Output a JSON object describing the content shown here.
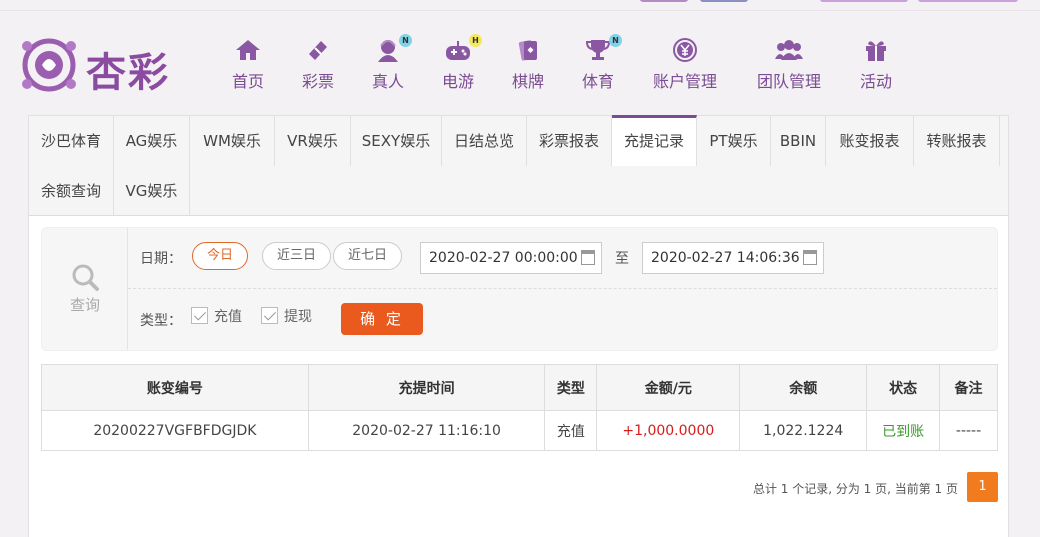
{
  "brand": {
    "name": "杏彩",
    "color": "#7b4b93",
    "accent": "#ea5a1e"
  },
  "nav": [
    {
      "label": "首页",
      "icon": "home-icon",
      "badge": ""
    },
    {
      "label": "彩票",
      "icon": "ticket-icon",
      "badge": ""
    },
    {
      "label": "真人",
      "icon": "dealer-icon",
      "badge": "N"
    },
    {
      "label": "电游",
      "icon": "gamepad-icon",
      "badge": "H"
    },
    {
      "label": "棋牌",
      "icon": "cards-icon",
      "badge": ""
    },
    {
      "label": "体育",
      "icon": "trophy-icon",
      "badge": "N"
    },
    {
      "label": "账户管理",
      "icon": "yen-icon",
      "badge": ""
    },
    {
      "label": "团队管理",
      "icon": "team-icon",
      "badge": ""
    },
    {
      "label": "活动",
      "icon": "gift-icon",
      "badge": ""
    }
  ],
  "tabs": [
    "沙巴体育",
    "AG娱乐",
    "WM娱乐",
    "VR娱乐",
    "SEXY娱乐",
    "日结总览",
    "彩票报表",
    "充提记录",
    "PT娱乐",
    "BBIN",
    "账变报表",
    "转账报表",
    "余额查询",
    "VG娱乐"
  ],
  "active_tab": "充提记录",
  "query": {
    "side_label": "查询",
    "date_label": "日期：",
    "quick": [
      "今日",
      "近三日",
      "近七日"
    ],
    "start": "2020-02-27 00:00:00",
    "to": "至",
    "end": "2020-02-27 14:06:36",
    "type_label": "类型：",
    "types": [
      "充值",
      "提现"
    ],
    "confirm": "确 定"
  },
  "table": {
    "headers": [
      "账变编号",
      "充提时间",
      "类型",
      "金额/元",
      "余额",
      "状态",
      "备注"
    ],
    "rows": [
      [
        "20200227VGFBFDGJDK",
        "2020-02-27 11:16:10",
        "充值",
        "+1,000.0000",
        "1,022.1224",
        "已到账",
        "-----"
      ]
    ]
  },
  "pager": {
    "summary": "总计 1 个记录, 分为 1 页, 当前第 1 页",
    "current": "1"
  }
}
